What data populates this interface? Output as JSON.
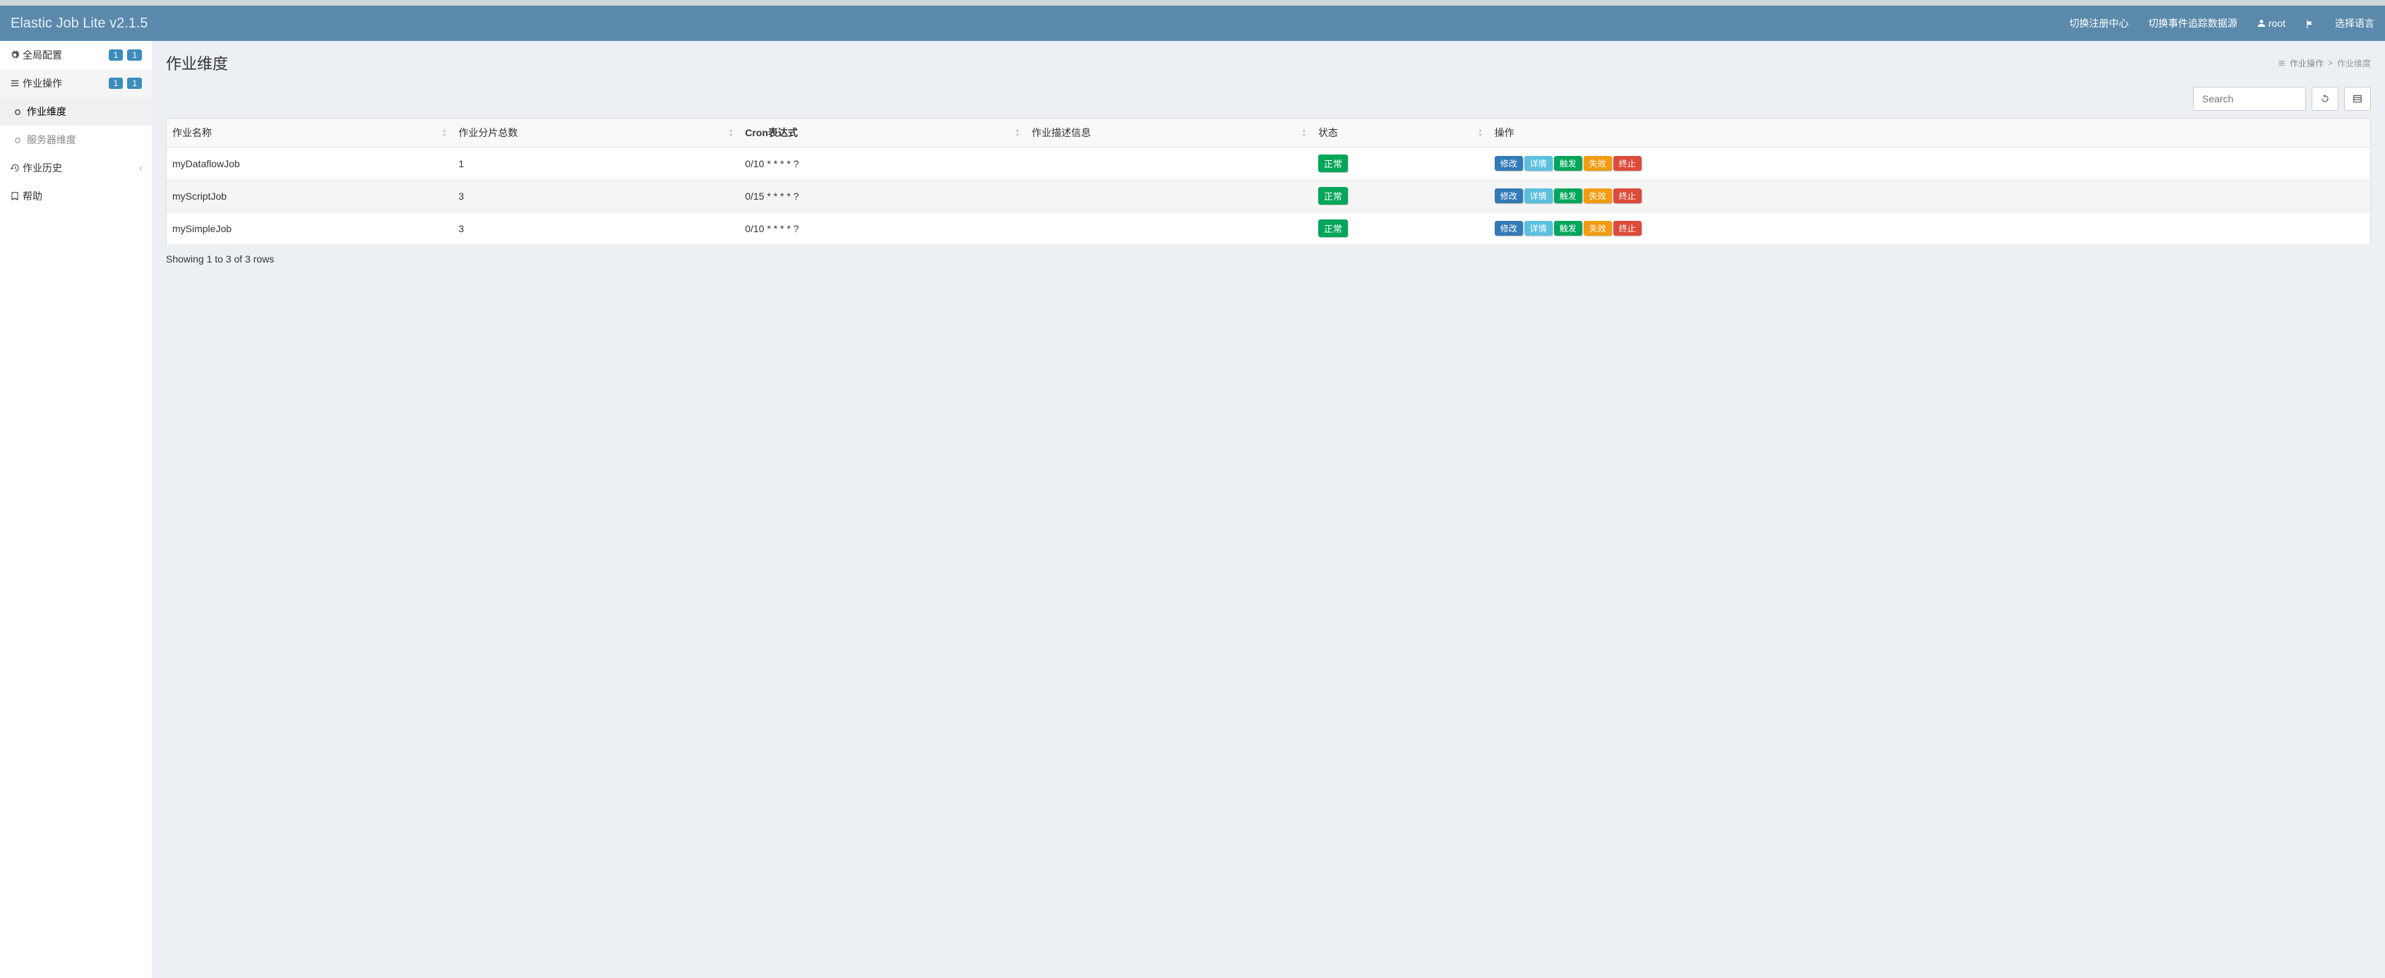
{
  "brand": "Elastic Job Lite v2.1.5",
  "nav": {
    "registry": "切换注册中心",
    "datasource": "切换事件追踪数据源",
    "user": "root",
    "language": "选择语言"
  },
  "sidebar": {
    "global": {
      "label": "全局配置",
      "badge1": "1",
      "badge2": "1"
    },
    "jobops": {
      "label": "作业操作",
      "badge1": "1",
      "badge2": "1"
    },
    "jobdim": {
      "label": "作业维度"
    },
    "serverdim": {
      "label": "服务器维度"
    },
    "history": {
      "label": "作业历史"
    },
    "help": {
      "label": "帮助"
    }
  },
  "page": {
    "title": "作业维度",
    "breadcrumb_root": "作业操作",
    "breadcrumb_current": "作业维度"
  },
  "search": {
    "placeholder": "Search"
  },
  "columns": {
    "name": "作业名称",
    "shard": "作业分片总数",
    "cron": "Cron表达式",
    "desc": "作业描述信息",
    "status": "状态",
    "ops": "操作"
  },
  "status_normal": "正常",
  "actions": {
    "edit": "修改",
    "detail": "详情",
    "trigger": "触发",
    "disable": "失效",
    "terminate": "终止"
  },
  "rows": [
    {
      "name": "myDataflowJob",
      "shard": "1",
      "cron": "0/10 * * * * ?",
      "desc": "",
      "status": "正常"
    },
    {
      "name": "myScriptJob",
      "shard": "3",
      "cron": "0/15 * * * * ?",
      "desc": "",
      "status": "正常"
    },
    {
      "name": "mySimpleJob",
      "shard": "3",
      "cron": "0/10 * * * * ?",
      "desc": "",
      "status": "正常"
    }
  ],
  "footer": "Showing 1 to 3 of 3 rows"
}
